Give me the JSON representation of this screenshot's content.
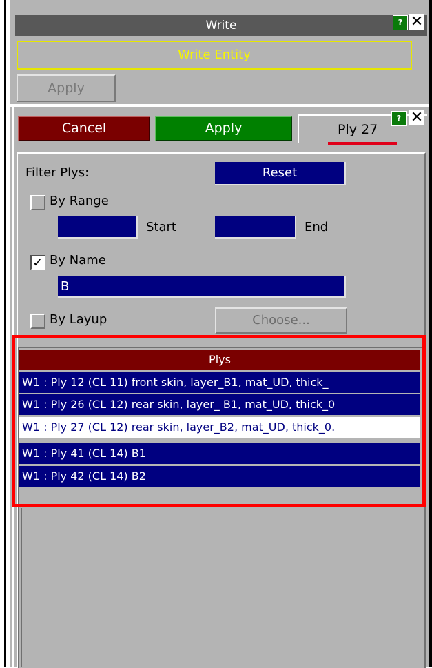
{
  "window": {
    "title": "Write",
    "help_label": "?",
    "close_label": "✕"
  },
  "write_panel": {
    "entity_label": "Write Entity",
    "apply_label": "Apply"
  },
  "ply_panel": {
    "cancel_label": "Cancel",
    "apply_label": "Apply",
    "tab_label": "Ply 27",
    "help_label": "?",
    "close_label": "✕"
  },
  "filter": {
    "title": "Filter Plys:",
    "reset_label": "Reset",
    "by_range_label": "By Range",
    "by_range_checked": false,
    "start_label": "Start",
    "end_label": "End",
    "start_value": "",
    "end_value": "",
    "by_name_label": "By Name",
    "by_name_checked": true,
    "name_value": "B",
    "by_layup_label": "By Layup",
    "by_layup_checked": false,
    "choose_label": "Choose..."
  },
  "list": {
    "header": "Plys",
    "items": [
      {
        "label": "W1 : Ply 12 (CL 11) front skin, layer_B1, mat_UD, thick_",
        "selected": false
      },
      {
        "label": "W1 : Ply 26 (CL 12) rear skin, layer_ B1, mat_UD, thick_0",
        "selected": false
      },
      {
        "label": "W1 : Ply 27 (CL 12) rear skin, layer_B2, mat_UD, thick_0.",
        "selected": true
      },
      {
        "label": "W1 : Ply 41 (CL 14) B1",
        "selected": false
      },
      {
        "label": "W1 : Ply 42 (CL 14) B2",
        "selected": false
      }
    ]
  },
  "colors": {
    "panel_bg": "#b4b4b4",
    "cancel": "#7a0000",
    "apply": "#008000",
    "field_blue": "#000080",
    "highlight_red": "#ff0000",
    "entity_yellow": "#f6f600"
  }
}
